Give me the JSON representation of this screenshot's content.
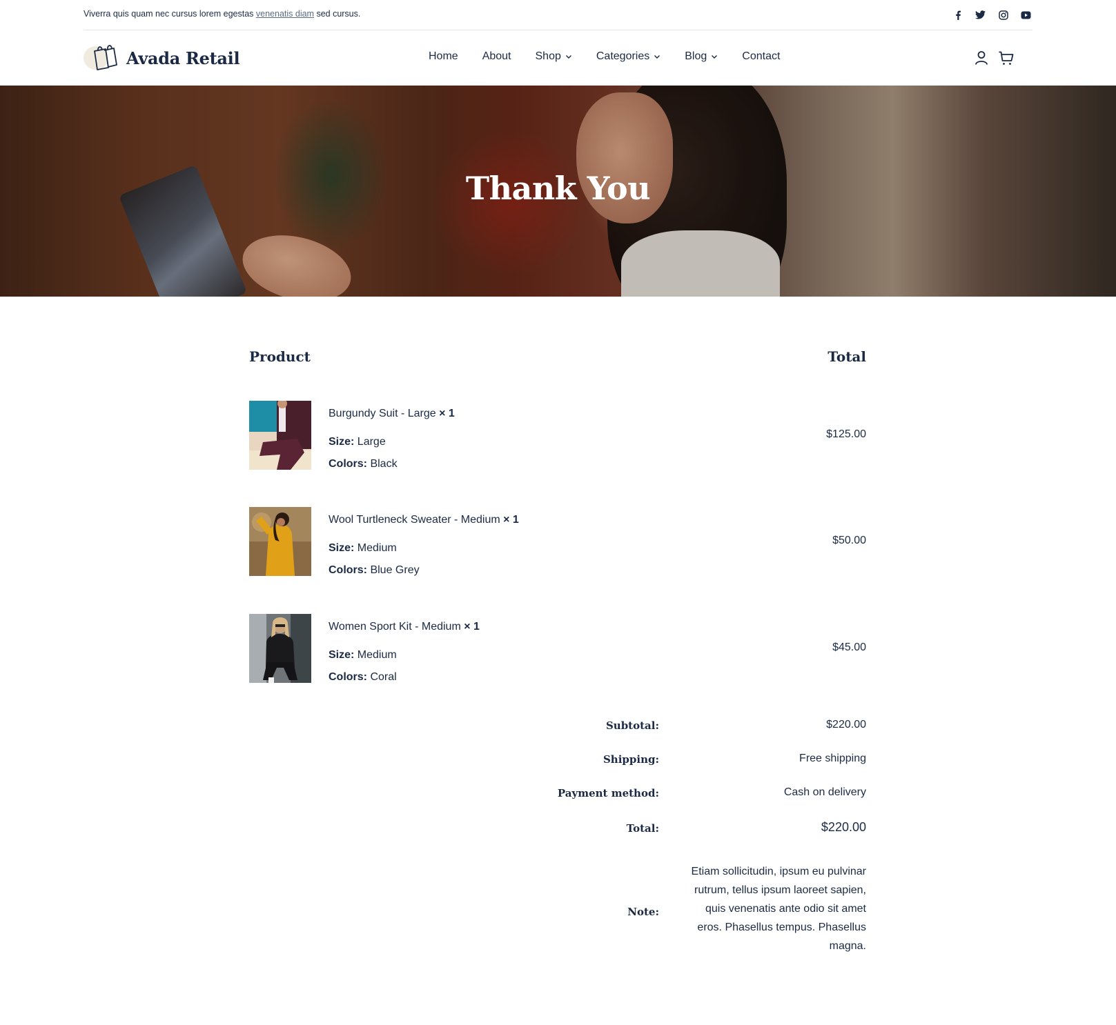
{
  "topbar": {
    "text_before": "Viverra quis quam nec cursus lorem egestas ",
    "link": "venenatis diam",
    "text_after": " sed cursus.",
    "socials": [
      "facebook-icon",
      "twitter-icon",
      "instagram-icon",
      "youtube-icon"
    ]
  },
  "header": {
    "logo_text": "Avada Retail",
    "nav": [
      {
        "label": "Home",
        "has_dropdown": false
      },
      {
        "label": "About",
        "has_dropdown": false
      },
      {
        "label": "Shop",
        "has_dropdown": true
      },
      {
        "label": "Categories",
        "has_dropdown": true
      },
      {
        "label": "Blog",
        "has_dropdown": true
      },
      {
        "label": "Contact",
        "has_dropdown": false
      }
    ],
    "icons": [
      "user-icon",
      "cart-icon"
    ]
  },
  "hero": {
    "title": "Thank You"
  },
  "order": {
    "col_product": "Product",
    "col_total": "Total",
    "items": [
      {
        "name": "Burgundy Suit - Large",
        "qty": "× 1",
        "size_label": "Size:",
        "size": "Large",
        "colors_label": "Colors:",
        "colors": "Black",
        "price": "$125.00"
      },
      {
        "name": "Wool Turtleneck Sweater - Medium",
        "qty": "× 1",
        "size_label": "Size:",
        "size": "Medium",
        "colors_label": "Colors:",
        "colors": "Blue Grey",
        "price": "$50.00"
      },
      {
        "name": "Women Sport Kit - Medium",
        "qty": "× 1",
        "size_label": "Size:",
        "size": "Medium",
        "colors_label": "Colors:",
        "colors": "Coral",
        "price": "$45.00"
      }
    ],
    "totals": {
      "subtotal_label": "Subtotal:",
      "subtotal": "$220.00",
      "shipping_label": "Shipping:",
      "shipping": "Free shipping",
      "payment_label": "Payment method:",
      "payment": "Cash on delivery",
      "total_label": "Total:",
      "total": "$220.00",
      "note_label": "Note:",
      "note": "Etiam sollicitudin, ipsum eu pulvinar rutrum, tellus ipsum laoreet sapien, quis venenatis ante odio sit amet eros. Phasellus tempus. Phasellus magna."
    }
  },
  "colors": {
    "text": "#1b2a44",
    "link_muted": "#5b6b86",
    "divider": "#e2e4e8",
    "logo_blob": "#f1ebdf"
  }
}
